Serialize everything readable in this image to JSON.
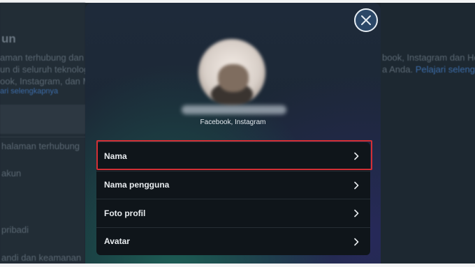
{
  "background": {
    "heading": "un",
    "left_lines": [
      "aman terhubung dan",
      "un di seluruh teknolog",
      "ook, Instagram, dan M",
      "ari selengkapnya"
    ],
    "right_lines": [
      "book, Instagram dan Hor",
      "a Anda."
    ],
    "right_link": "Pelajari selengkap",
    "left_items": [
      "halaman terhubung",
      "akun",
      "pribadi",
      "andi dan keamanan"
    ]
  },
  "modal": {
    "accounts_label": "Facebook, Instagram",
    "menu_items": [
      {
        "label": "Nama",
        "chevron": "chevron-right-icon"
      },
      {
        "label": "Nama pengguna",
        "chevron": "chevron-right-icon"
      },
      {
        "label": "Foto profil",
        "chevron": "chevron-right-icon"
      },
      {
        "label": "Avatar",
        "chevron": "chevron-right-icon"
      }
    ],
    "close_icon": "close-icon"
  },
  "colors": {
    "highlight": "#d32f35",
    "menu_bg": "#0f151a",
    "close_bg": "#2b4767"
  }
}
